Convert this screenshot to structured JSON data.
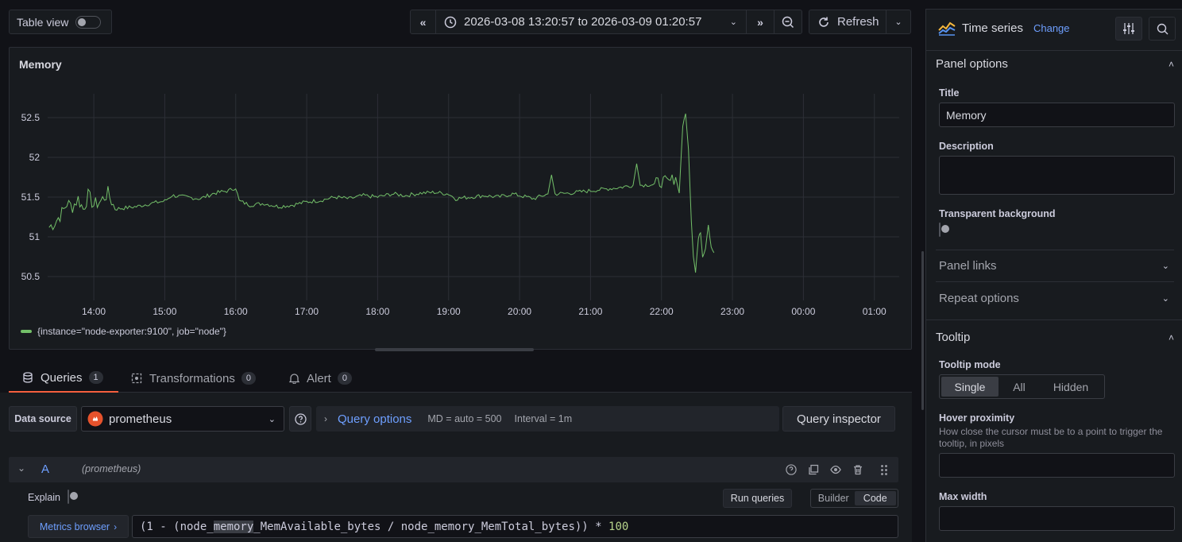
{
  "toolbar": {
    "table_view_label": "Table view",
    "time_range": "2026-03-08 13:20:57 to 2026-03-09 01:20:57",
    "refresh_label": "Refresh"
  },
  "panel": {
    "title": "Memory",
    "legend": "{instance=\"node-exporter:9100\", job=\"node\"}",
    "series_color": "#73bf69"
  },
  "chart_data": {
    "type": "line",
    "title": "Memory",
    "x_ticks": [
      "14:00",
      "15:00",
      "16:00",
      "17:00",
      "18:00",
      "19:00",
      "20:00",
      "21:00",
      "22:00",
      "23:00",
      "00:00",
      "01:00"
    ],
    "y_ticks": [
      "52.5",
      "52",
      "51.5",
      "51",
      "50.5"
    ],
    "ylim": [
      50.2,
      52.8
    ],
    "xlim_hours": [
      13.35,
      25.35
    ],
    "series": [
      {
        "name": "{instance=\"node-exporter:9100\", job=\"node\"}",
        "points": [
          [
            13.37,
            51.12
          ],
          [
            13.45,
            51.18
          ],
          [
            13.55,
            51.3
          ],
          [
            13.62,
            51.42
          ],
          [
            13.7,
            51.38
          ],
          [
            13.78,
            51.48
          ],
          [
            13.85,
            51.35
          ],
          [
            13.92,
            51.52
          ],
          [
            14.0,
            51.4
          ],
          [
            14.1,
            51.45
          ],
          [
            14.2,
            51.55
          ],
          [
            14.3,
            51.35
          ],
          [
            14.4,
            51.36
          ],
          [
            14.6,
            51.38
          ],
          [
            14.8,
            51.42
          ],
          [
            15.0,
            51.45
          ],
          [
            15.1,
            51.52
          ],
          [
            15.3,
            51.5
          ],
          [
            15.5,
            51.48
          ],
          [
            15.7,
            51.55
          ],
          [
            15.9,
            51.58
          ],
          [
            16.0,
            51.62
          ],
          [
            16.05,
            51.45
          ],
          [
            16.2,
            51.4
          ],
          [
            16.4,
            51.42
          ],
          [
            16.6,
            51.38
          ],
          [
            16.8,
            51.4
          ],
          [
            17.0,
            51.44
          ],
          [
            17.2,
            51.46
          ],
          [
            17.4,
            51.5
          ],
          [
            17.6,
            51.48
          ],
          [
            17.8,
            51.52
          ],
          [
            18.0,
            51.5
          ],
          [
            18.2,
            51.54
          ],
          [
            18.4,
            51.52
          ],
          [
            18.6,
            51.55
          ],
          [
            18.8,
            51.56
          ],
          [
            19.0,
            51.54
          ],
          [
            19.1,
            51.48
          ],
          [
            19.3,
            51.5
          ],
          [
            19.5,
            51.52
          ],
          [
            19.7,
            51.5
          ],
          [
            19.9,
            51.54
          ],
          [
            20.0,
            51.52
          ],
          [
            20.2,
            51.48
          ],
          [
            20.4,
            51.54
          ],
          [
            20.45,
            51.78
          ],
          [
            20.5,
            51.54
          ],
          [
            20.7,
            51.55
          ],
          [
            20.9,
            51.57
          ],
          [
            21.0,
            51.58
          ],
          [
            21.2,
            51.6
          ],
          [
            21.4,
            51.62
          ],
          [
            21.6,
            51.65
          ],
          [
            21.65,
            51.92
          ],
          [
            21.7,
            51.65
          ],
          [
            21.9,
            51.66
          ],
          [
            22.0,
            51.7
          ],
          [
            22.1,
            51.68
          ],
          [
            22.2,
            51.75
          ],
          [
            22.25,
            51.55
          ],
          [
            22.3,
            52.4
          ],
          [
            22.34,
            52.55
          ],
          [
            22.38,
            52.1
          ],
          [
            22.42,
            51.2
          ],
          [
            22.45,
            50.75
          ],
          [
            22.48,
            50.55
          ],
          [
            22.52,
            51.0
          ],
          [
            22.55,
            51.05
          ],
          [
            22.58,
            50.75
          ],
          [
            22.62,
            50.85
          ],
          [
            22.66,
            51.15
          ],
          [
            22.7,
            50.85
          ],
          [
            22.74,
            50.8
          ]
        ]
      }
    ]
  },
  "tabs": {
    "queries_label": "Queries",
    "queries_count": "1",
    "transformations_label": "Transformations",
    "transformations_count": "0",
    "alert_label": "Alert",
    "alert_count": "0"
  },
  "datasource": {
    "label": "Data source",
    "value": "prometheus",
    "query_options_label": "Query options",
    "md": "MD = auto = 500",
    "interval": "Interval = 1m",
    "inspector_label": "Query inspector"
  },
  "query": {
    "ref": "A",
    "datasource_hint": "(prometheus)",
    "explain_label": "Explain",
    "run_label": "Run queries",
    "builder_label": "Builder",
    "code_label": "Code",
    "metrics_browser_label": "Metrics browser",
    "expr_prefix": "(1 - (node_",
    "expr_highlight": "memory",
    "expr_mid": "_MemAvailable_bytes / node_memory_MemTotal_bytes)) * ",
    "expr_number": "100"
  },
  "options_pane": {
    "viz_name": "Time series",
    "change_label": "Change",
    "panel_options_header": "Panel options",
    "title_label": "Title",
    "title_value": "Memory",
    "description_label": "Description",
    "transparent_label": "Transparent background",
    "panel_links_label": "Panel links",
    "repeat_options_label": "Repeat options",
    "tooltip_header": "Tooltip",
    "tooltip_mode_label": "Tooltip mode",
    "tooltip_modes": [
      "Single",
      "All",
      "Hidden"
    ],
    "hover_proximity_label": "Hover proximity",
    "hover_proximity_desc": "How close the cursor must be to a point to trigger the tooltip, in pixels",
    "max_width_label": "Max width"
  }
}
